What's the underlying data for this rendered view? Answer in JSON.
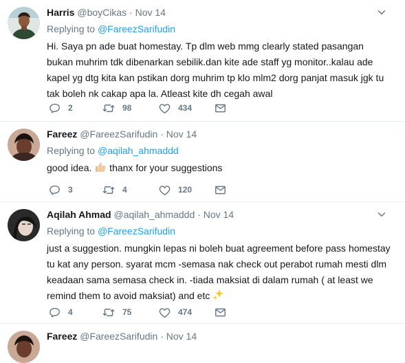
{
  "tweets": [
    {
      "name": "Harris",
      "handle": "@boyCikas",
      "separator": "·",
      "date": "Nov 14",
      "replying_prefix": "Replying to ",
      "replying_to": "@FareezSarifudin",
      "text": "Hi. Saya pn ade buat homestay. Tp dlm web mmg clearly stated pasangan bukan muhrim tdk dibenarkan sebilik.dan kite ade staff yg monitor..kalau ade kapel yg dtg kita kan pstikan dorg muhrim tp klo mlm2 dorg panjat masuk jgk tu tak boleh nk cakap apa la. Atleast kite dh cegah awal",
      "replies": "2",
      "retweets": "98",
      "likes": "434"
    },
    {
      "name": "Fareez",
      "handle": "@FareezSarifudin",
      "separator": "·",
      "date": "Nov 14",
      "replying_prefix": "Replying to ",
      "replying_to": "@aqilah_ahmaddd",
      "text_before_emoji": "good idea. ",
      "emoji": "thumbs-up-icon",
      "text_after_emoji": " thanx for your suggestions",
      "replies": "3",
      "retweets": "4",
      "likes": "120"
    },
    {
      "name": "Aqilah Ahmad",
      "handle": "@aqilah_ahmaddd",
      "separator": "·",
      "date": "Nov 14",
      "replying_prefix": "Replying to ",
      "replying_to": "@FareezSarifudin",
      "text_before_emoji": "just a suggestion. mungkin lepas ni boleh buat agreement before pass homestay tu kat any person. syarat mcm -semasa nak check out perabot rumah mesti dlm keadaan sama semasa check in. -tiada maksiat di dalam rumah ( at least we remind them to avoid maksiat) and etc ",
      "emoji": "sparkles-icon",
      "replies": "4",
      "retweets": "75",
      "likes": "474"
    },
    {
      "name": "Fareez",
      "handle": "@FareezSarifudin",
      "separator": "·",
      "date": "Nov 14"
    }
  ],
  "colors": {
    "link": "#1da1f2",
    "muted": "#657786",
    "text": "#14171a",
    "divider": "#e6ecf0"
  }
}
